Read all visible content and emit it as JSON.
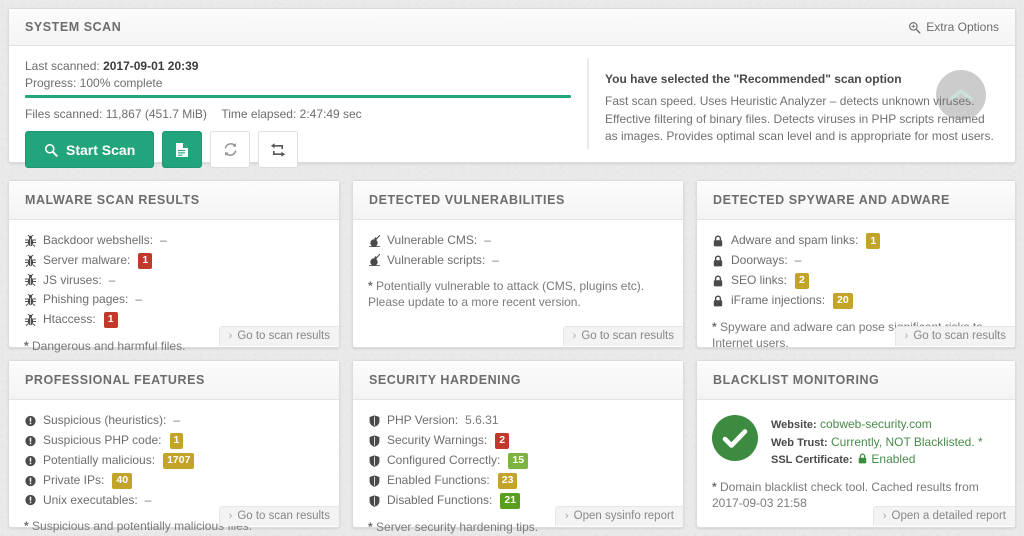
{
  "system_scan": {
    "title": "SYSTEM SCAN",
    "extra_options_label": "Extra Options",
    "extra_options_icon": "search-plus-icon",
    "last_scanned_label": "Last scanned:",
    "last_scanned_value": "2017-09-01 20:39",
    "progress_label": "Progress: 100% complete",
    "progress_percent": 100,
    "progress_color": "#23a47c",
    "files_scanned_label": "Files scanned:",
    "files_scanned_value": "11,867 (451.7 MiB)",
    "time_elapsed_label": "Time elapsed:",
    "time_elapsed_value": "2:47:49 sec",
    "buttons": {
      "start_scan_label": "Start Scan",
      "start_scan_icon": "search-icon",
      "report_icon": "file-text-icon",
      "refresh_icon": "refresh-icon",
      "retweet_icon": "retweet-icon"
    },
    "recommended": {
      "title": "You have selected the \"Recommended\" scan option",
      "text": "Fast scan speed. Uses Heuristic Analyzer – detects unknown viruses. Effective filtering of binary files. Detects viruses in PHP scripts renamed as images. Provides optimal scan level and is appropriate for most users."
    }
  },
  "scroll_top": {
    "icon": "chevron-up-icon"
  },
  "cards": [
    {
      "id": "malware-scan-results",
      "title": "MALWARE SCAN RESULTS",
      "icon": "bug-icon",
      "rows": [
        {
          "label": "Backdoor webshells:",
          "value": "–",
          "badge": null
        },
        {
          "label": "Server malware:",
          "value": null,
          "badge": "1",
          "badge_color": "#c0392b"
        },
        {
          "label": "JS viruses:",
          "value": "–",
          "badge": null
        },
        {
          "label": "Phishing pages:",
          "value": "–",
          "badge": null
        },
        {
          "label": "Htaccess:",
          "value": null,
          "badge": "1",
          "badge_color": "#c0392b"
        }
      ],
      "note": "Dangerous and harmful files.",
      "footer": "Go to scan results"
    },
    {
      "id": "detected-vulnerabilities",
      "title": "DETECTED VULNERABILITIES",
      "icon": "bomb-icon",
      "rows": [
        {
          "label": "Vulnerable CMS:",
          "value": "–",
          "badge": null
        },
        {
          "label": "Vulnerable scripts:",
          "value": "–",
          "badge": null
        }
      ],
      "note": "Potentially vulnerable to attack (CMS, plugins etc). Please update to a more recent version.",
      "footer": "Go to scan results"
    },
    {
      "id": "detected-spyware-and-adware",
      "title": "DETECTED SPYWARE AND ADWARE",
      "icon": "lock-icon",
      "rows": [
        {
          "label": "Adware and spam links:",
          "value": null,
          "badge": "1",
          "badge_color": "#c3a429"
        },
        {
          "label": "Doorways:",
          "value": "–",
          "badge": null
        },
        {
          "label": "SEO links:",
          "value": null,
          "badge": "2",
          "badge_color": "#c3a429"
        },
        {
          "label": "iFrame injections:",
          "value": null,
          "badge": "20",
          "badge_color": "#c3a429"
        }
      ],
      "note": "Spyware and adware can pose significant risks to Internet users.",
      "footer": "Go to scan results"
    },
    {
      "id": "professional-features",
      "title": "PROFESSIONAL FEATURES",
      "icon": "exclamation-circle-icon",
      "rows": [
        {
          "label": "Suspicious (heuristics):",
          "value": "–",
          "badge": null
        },
        {
          "label": "Suspicious PHP code:",
          "value": null,
          "badge": "1",
          "badge_color": "#c3a429"
        },
        {
          "label": "Potentially malicious:",
          "value": null,
          "badge": "1707",
          "badge_color": "#c3a429"
        },
        {
          "label": "Private IPs:",
          "value": null,
          "badge": "40",
          "badge_color": "#c3a429"
        },
        {
          "label": "Unix executables:",
          "value": "–",
          "badge": null
        }
      ],
      "note": "Suspicious and potentially malicious files.",
      "footer": "Go to scan results"
    },
    {
      "id": "security-hardening",
      "title": "SECURITY HARDENING",
      "icon": "shield-icon",
      "rows": [
        {
          "label": "PHP Version:",
          "value": "5.6.31",
          "badge": null
        },
        {
          "label": "Security Warnings:",
          "value": null,
          "badge": "2",
          "badge_color": "#c0392b"
        },
        {
          "label": "Configured Correctly:",
          "value": null,
          "badge": "15",
          "badge_color": "#7cb342"
        },
        {
          "label": "Enabled Functions:",
          "value": null,
          "badge": "23",
          "badge_color": "#c3a429"
        },
        {
          "label": "Disabled Functions:",
          "value": null,
          "badge": "21",
          "badge_color": "#5a9e1f"
        }
      ],
      "note": "Server security hardening tips.",
      "footer": "Open sysinfo report"
    }
  ],
  "blacklist": {
    "id": "blacklist-monitoring",
    "title": "BLACKLIST MONITORING",
    "check_icon": "check-circle-icon",
    "check_color": "#3d8b40",
    "website_label": "Website:",
    "website_value": "cobweb-security.com",
    "webtrust_label": "Web Trust:",
    "webtrust_value": "Currently, NOT Blacklisted.",
    "webtrust_asterisk": "*",
    "ssl_label": "SSL Certificate:",
    "ssl_icon": "lock-icon",
    "ssl_value": "Enabled",
    "note": "Domain blacklist check tool. Cached results from 2017-09-03 21:58",
    "footer": "Open a detailed report"
  }
}
